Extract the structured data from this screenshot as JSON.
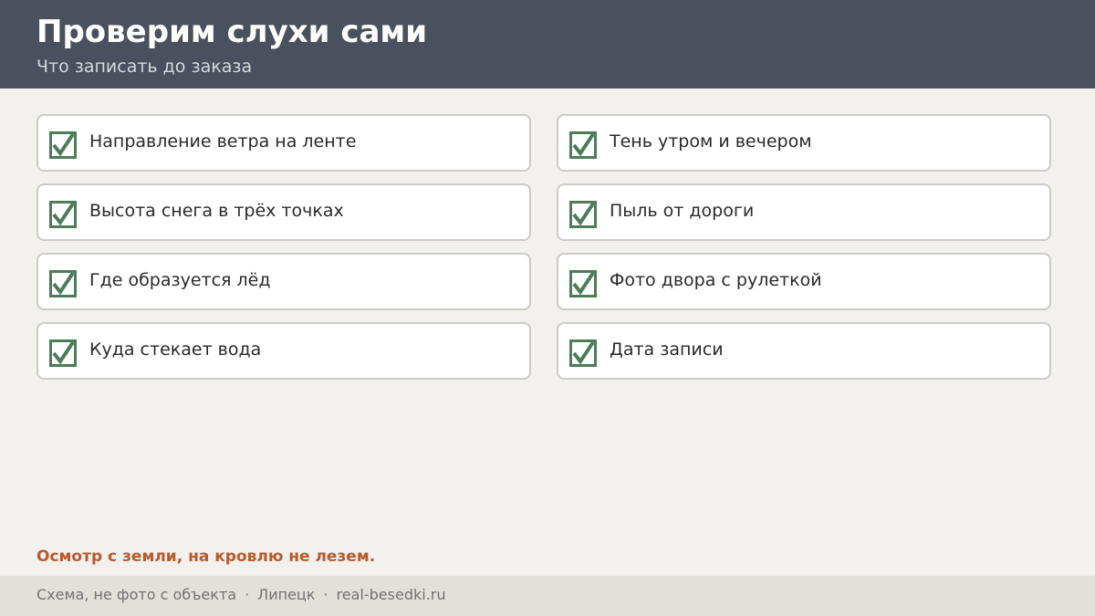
{
  "header": {
    "title": "Проверим слухи сами",
    "subtitle": "Что записать до заказа"
  },
  "checklist": {
    "left": [
      {
        "label": "Направление ветра на ленте",
        "checked": true
      },
      {
        "label": "Высота снега в трёх точках",
        "checked": true
      },
      {
        "label": "Где образуется лёд",
        "checked": true
      },
      {
        "label": "Куда стекает вода",
        "checked": true
      }
    ],
    "right": [
      {
        "label": "Тень утром и вечером",
        "checked": true
      },
      {
        "label": "Пыль от дороги",
        "checked": true
      },
      {
        "label": "Фото двора с рулеткой",
        "checked": true
      },
      {
        "label": "Дата записи",
        "checked": true
      }
    ]
  },
  "note": "Осмотр с земли, на кровлю не лезем.",
  "footer": {
    "part1": "Схема, не фото с объекта",
    "separator": "·",
    "part2": "Липецк",
    "part3": "real-besedki.ru"
  },
  "colors": {
    "header_bg": "#48515d",
    "check_green": "#4e7b5a",
    "accent_orange": "#b95a2a"
  }
}
